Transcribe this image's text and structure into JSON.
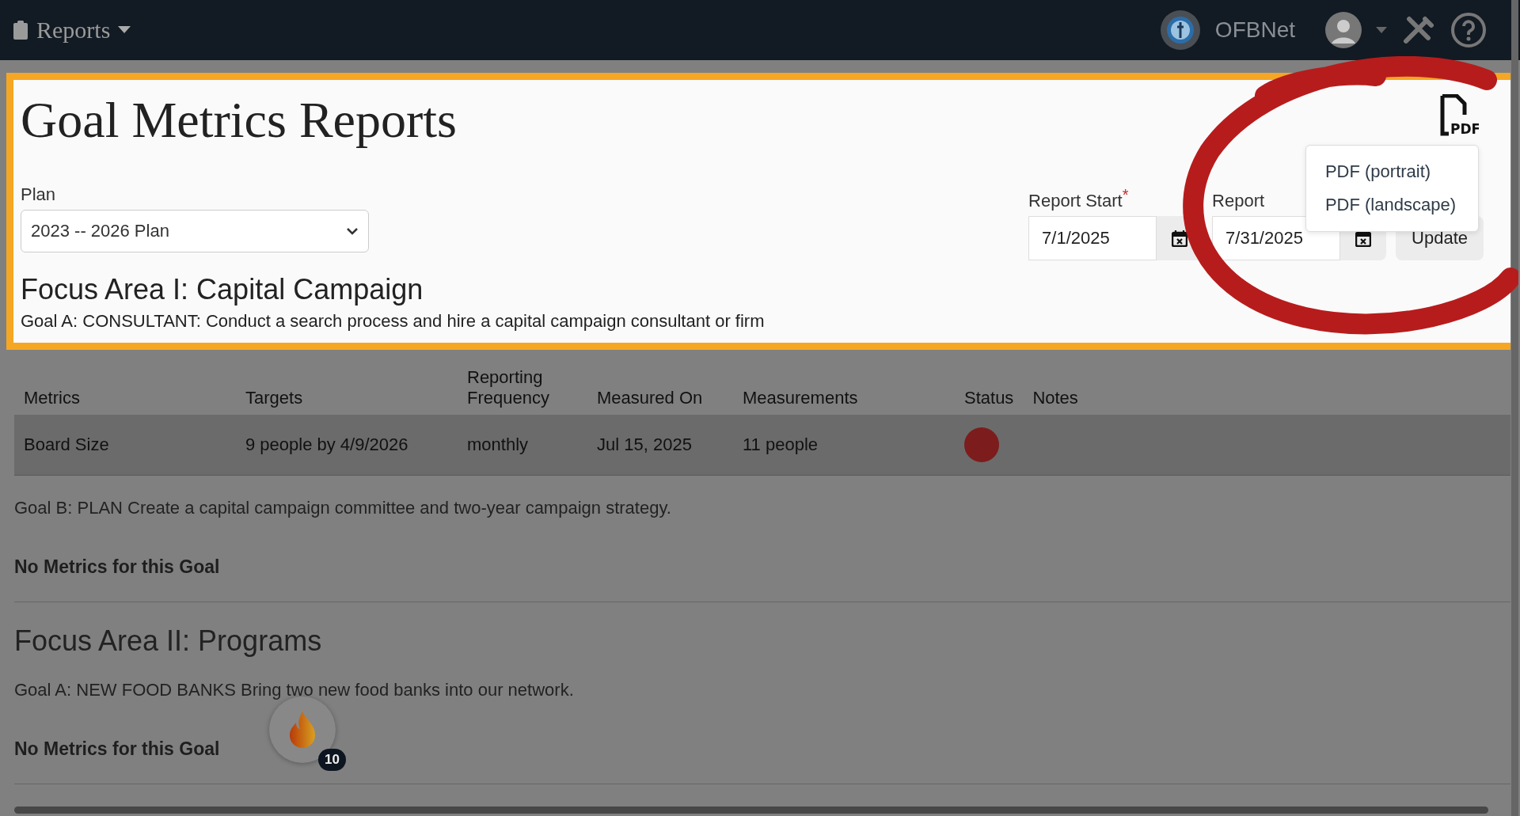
{
  "top_bar": {
    "menu_title": "Reports",
    "org_name": "OFBNet"
  },
  "page": {
    "title": "Goal Metrics Reports",
    "plan": {
      "label": "Plan",
      "value": "2023 -- 2026 Plan"
    },
    "report_start": {
      "label": "Report Start",
      "required_mark": "*",
      "value": "7/1/2025"
    },
    "report_end": {
      "label": "Report",
      "value": "7/31/2025"
    },
    "update_button": "Update",
    "pdf_icon_label": "PDF",
    "export_menu": {
      "items": [
        "PDF (portrait)",
        "PDF (landscape)"
      ]
    }
  },
  "focus_areas": [
    {
      "title": "Focus Area I: Capital Campaign",
      "goals": [
        {
          "text": "Goal A: CONSULTANT: Conduct a search process and hire a capital campaign consultant or firm",
          "table": {
            "columns": [
              "Metrics",
              "Targets",
              "Reporting Frequency",
              "Measured On",
              "Measurements",
              "Status",
              "Notes"
            ],
            "rows": [
              {
                "cells": [
                  "Board Size",
                  "9 people by 4/9/2026",
                  "monthly",
                  "Jul 15, 2025",
                  "11 people"
                ],
                "color": "#7d1c1c"
              }
            ]
          }
        },
        {
          "text": "Goal B: PLAN Create a capital campaign committee and two-year campaign strategy.",
          "no_metrics": "No Metrics for this Goal"
        }
      ]
    },
    {
      "title": "Focus Area II: Programs",
      "goals": [
        {
          "text": "Goal A: NEW FOOD BANKS Bring two new food banks into our network.",
          "no_metrics": "No Metrics for this Goal"
        }
      ]
    }
  ],
  "floating_button": {
    "badge": "10"
  }
}
